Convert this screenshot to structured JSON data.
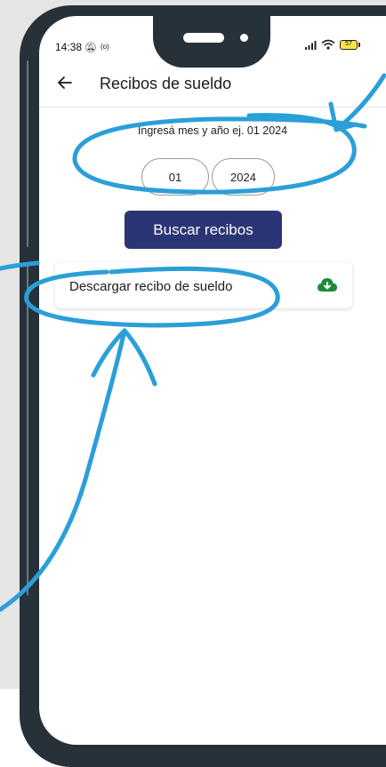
{
  "status": {
    "time": "14:38",
    "battery": "57"
  },
  "header": {
    "title": "Recibos de sueldo"
  },
  "form": {
    "hint": "Ingresá mes y año ej. 01 2024",
    "month_value": "01",
    "year_value": "2024",
    "search_label": "Buscar recibos"
  },
  "receipt": {
    "label": "Descargar recibo de sueldo"
  },
  "colors": {
    "primary_button": "#2b3474",
    "download_icon": "#1f8a3a",
    "annotation": "#2a9fd8",
    "phone_frame": "#26313a"
  },
  "icons": [
    "back-arrow-icon",
    "mute-bell-icon",
    "signal-icon",
    "wifi-icon",
    "battery-icon",
    "cloud-download-icon"
  ]
}
